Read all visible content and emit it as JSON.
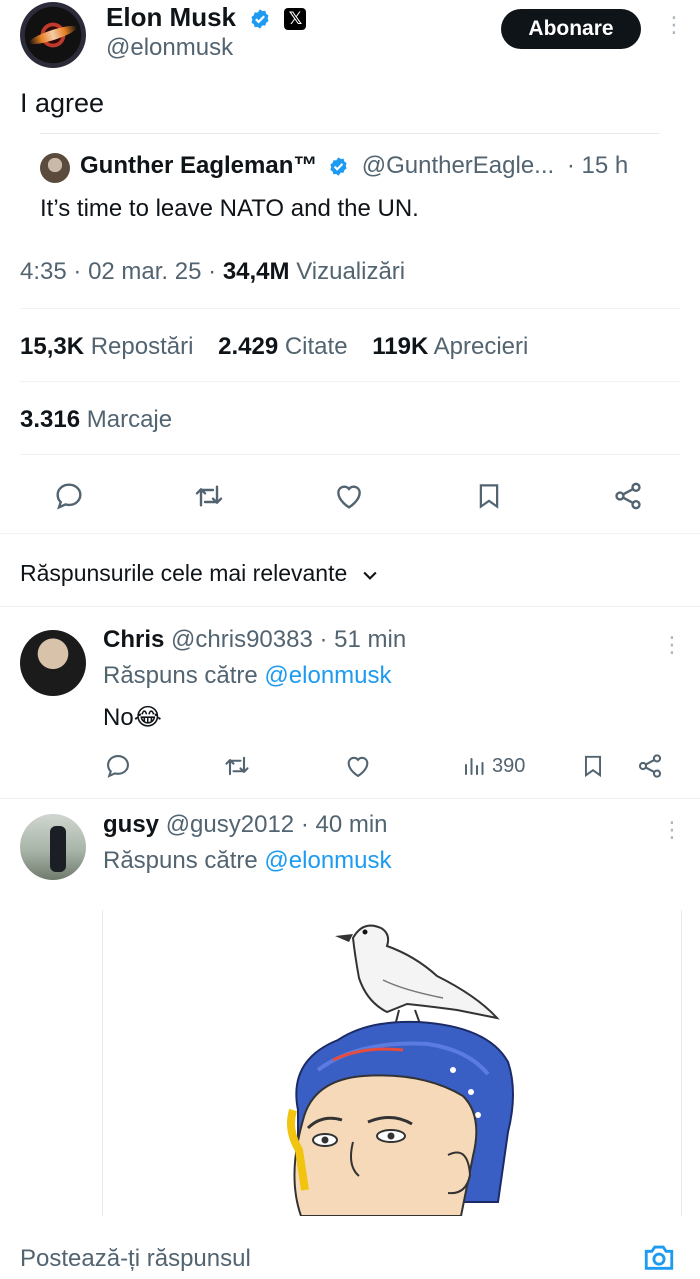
{
  "post": {
    "author_name": "Elon Musk",
    "author_handle": "@elonmusk",
    "subscribe_label": "Abonare",
    "text": "I agree",
    "quote": {
      "name": "Gunther Eagleman™",
      "handle": "@GuntherEagle...",
      "time": "· 15 h",
      "text": "It’s time to leave NATO and the UN."
    },
    "meta": {
      "time": "4:35",
      "date": "02 mar. 25",
      "views_count": "34,4M",
      "views_label": "Vizualizări"
    },
    "stats": {
      "reposts_count": "15,3K",
      "reposts_label": "Repostări",
      "quotes_count": "2.429",
      "quotes_label": "Citate",
      "likes_count": "119K",
      "likes_label": "Aprecieri",
      "bookmarks_count": "3.316",
      "bookmarks_label": "Marcaje"
    },
    "actions": [
      "reply-icon",
      "repost-icon",
      "like-icon",
      "bookmark-icon",
      "share-icon"
    ]
  },
  "replies_sort": {
    "label": "Răspunsurile cele mai relevante"
  },
  "replies": [
    {
      "name": "Chris",
      "handle": "@chris90383",
      "time": "· 51 min",
      "reply_to_prefix": "Răspuns către",
      "reply_to_handle": "@elonmusk",
      "text": "No",
      "emoji": "😂",
      "views": "390"
    },
    {
      "name": "gusy",
      "handle": "@gusy2012",
      "time": "· 40 min",
      "reply_to_prefix": "Răspuns către",
      "reply_to_handle": "@elonmusk"
    }
  ],
  "composer": {
    "placeholder": "Postează-ți răspunsul"
  },
  "colors": {
    "accent": "#1d9bf0",
    "text": "#0f1419",
    "muted": "#536471"
  }
}
